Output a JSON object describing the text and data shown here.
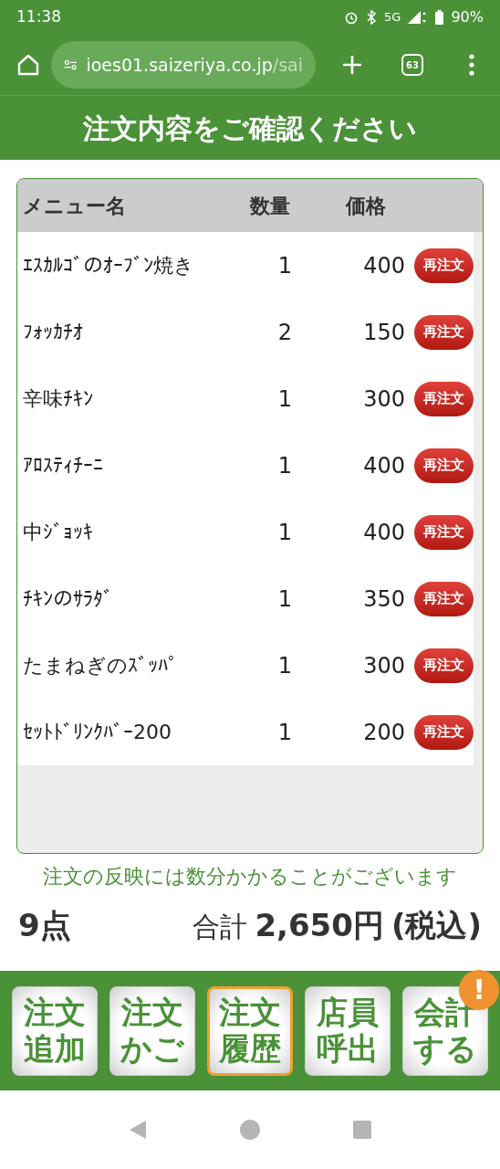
{
  "status_bar": {
    "time": "11:38",
    "network": "5G",
    "battery": "90%"
  },
  "browser": {
    "url_main": "ioes01.saizeriya.co.jp",
    "url_rest": "/sai",
    "tab_count": "63"
  },
  "page_title": "注文内容をご確認ください",
  "table": {
    "columns": [
      "メニュー名",
      "数量",
      "価格"
    ],
    "rows": [
      {
        "name": "ｴｽｶﾙｺﾞのｵｰﾌﾞﾝ焼き",
        "qty": "1",
        "price": "400",
        "action": "再注文"
      },
      {
        "name": "ﾌｫｯｶﾁｵ",
        "qty": "2",
        "price": "150",
        "action": "再注文"
      },
      {
        "name": "辛味ﾁｷﾝ",
        "qty": "1",
        "price": "300",
        "action": "再注文"
      },
      {
        "name": "ｱﾛｽﾃｨﾁｰﾆ",
        "qty": "1",
        "price": "400",
        "action": "再注文"
      },
      {
        "name": "中ｼﾞｮｯｷ",
        "qty": "1",
        "price": "400",
        "action": "再注文"
      },
      {
        "name": "ﾁｷﾝのｻﾗﾀﾞ",
        "qty": "1",
        "price": "350",
        "action": "再注文"
      },
      {
        "name": "たまねぎのｽﾞｯﾊﾟ",
        "qty": "1",
        "price": "300",
        "action": "再注文"
      },
      {
        "name": "ｾｯﾄﾄﾞﾘﾝｸﾊﾞｰ200",
        "qty": "1",
        "price": "200",
        "action": "再注文"
      }
    ]
  },
  "note": "注文の反映には数分かかることがございます",
  "summary": {
    "count": "9点",
    "total_label": "合計",
    "total": "2,650円",
    "tax": "(税込)"
  },
  "bottom_nav": [
    {
      "line1": "注文",
      "line2": "追加",
      "selected": false
    },
    {
      "line1": "注文",
      "line2": "かご",
      "selected": false
    },
    {
      "line1": "注文",
      "line2": "履歴",
      "selected": true
    },
    {
      "line1": "店員",
      "line2": "呼出",
      "selected": false
    },
    {
      "line1": "会計",
      "line2": "する",
      "selected": false,
      "badge": "!"
    }
  ]
}
